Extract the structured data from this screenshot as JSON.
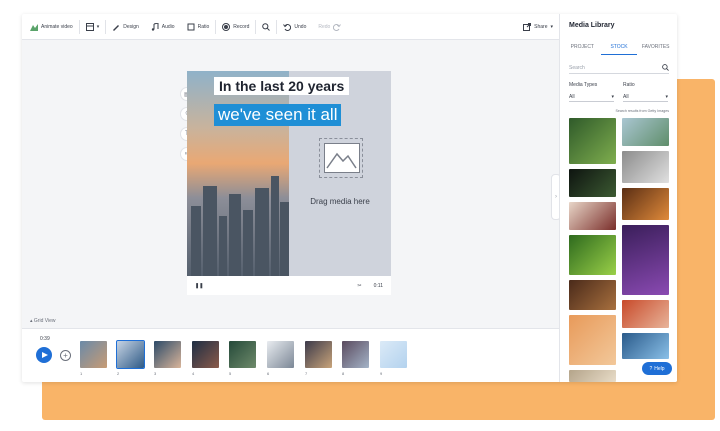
{
  "toolbar": {
    "items": [
      {
        "label": "Animate video",
        "icon": "animate-icon"
      },
      {
        "label": "",
        "icon": "layout-icon"
      },
      {
        "label": "Design",
        "icon": "pen-icon"
      },
      {
        "label": "Audio",
        "icon": "music-icon"
      },
      {
        "label": "Ratio",
        "icon": "ratio-icon"
      },
      {
        "label": "Record",
        "icon": "record-icon"
      },
      {
        "label": "",
        "icon": "search-icon"
      },
      {
        "label": "Undo",
        "icon": "undo-icon"
      },
      {
        "label": "Redo",
        "icon": "redo-icon"
      }
    ],
    "share_label": "Share"
  },
  "canvas": {
    "headline_1": "In the last 20 years",
    "headline_2": "we've seen it all",
    "drop_label": "Drag media here",
    "time": "0:11",
    "accent": "#1f8fd6"
  },
  "timeline": {
    "grid_view_label": "Grid View",
    "current_time": "0:39",
    "scenes": [
      "1",
      "2",
      "3",
      "4",
      "5",
      "6",
      "7",
      "8",
      "9"
    ]
  },
  "media_library": {
    "title": "Media Library",
    "tabs": [
      "PROJECT",
      "STOCK",
      "FAVORITES"
    ],
    "active_tab": "STOCK",
    "search_placeholder": "Search",
    "media_types_label": "Media Types",
    "media_types_value": "All",
    "ratio_label": "Ratio",
    "ratio_value": "All",
    "source_note": "Search results from Getty Images",
    "help_label": "Help"
  },
  "colors": {
    "brand_blue": "#1f6fd6",
    "orange_backdrop": "#f9b468"
  }
}
